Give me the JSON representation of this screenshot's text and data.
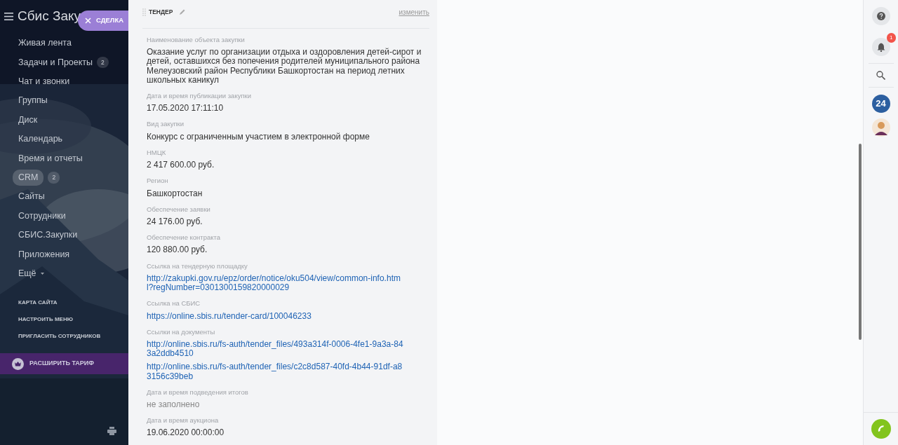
{
  "sidebar": {
    "title": "Сбис Заку",
    "action_button": "СДЕЛКА",
    "items": [
      {
        "label": "Живая лента",
        "selected": false
      },
      {
        "label": "Задачи и Проекты",
        "badge": "2",
        "selected": false
      },
      {
        "label": "Чат и звонки",
        "selected": false
      },
      {
        "label": "Группы",
        "selected": false
      },
      {
        "label": "Диск",
        "selected": false
      },
      {
        "label": "Календарь",
        "selected": false
      },
      {
        "label": "Время и отчеты",
        "selected": false
      },
      {
        "label": "CRM",
        "badge": "2",
        "selected": true
      },
      {
        "label": "Сайты",
        "selected": false
      },
      {
        "label": "Сотрудники",
        "selected": false
      },
      {
        "label": "СБИС.Закупки",
        "selected": false
      },
      {
        "label": "Приложения",
        "selected": false
      },
      {
        "label": "Ещё",
        "selected": false,
        "dropdown": true
      }
    ],
    "links": [
      "КАРТА САЙТА",
      "НАСТРОИТЬ МЕНЮ",
      "ПРИГЛАСИТЬ СОТРУДНИКОВ"
    ],
    "upgrade": "РАСШИРИТЬ ТАРИФ"
  },
  "panel": {
    "title": "ТЕНДЕР",
    "edit_link": "изменить",
    "fields": [
      {
        "label": "Наименование объекта закупки",
        "kind": "text",
        "values": [
          "Оказание услуг по организации отдыха и оздоровления детей-сирот и детей, оставшихся без попечения родителей муниципального района Мелеузовский район Республики Башкортостан на период летних школьных каникул"
        ]
      },
      {
        "label": "Дата и время публикации закупки",
        "kind": "text",
        "values": [
          "17.05.2020 17:11:10"
        ]
      },
      {
        "label": "Вид закупки",
        "kind": "text",
        "values": [
          "Конкурс с ограниченным участием в электронной форме"
        ]
      },
      {
        "label": "НМЦК",
        "kind": "text",
        "values": [
          "2 417 600.00 руб."
        ]
      },
      {
        "label": "Регион",
        "kind": "text",
        "values": [
          "Башкортостан"
        ]
      },
      {
        "label": "Обеспечение заявки",
        "kind": "text",
        "values": [
          "24 176.00 руб."
        ]
      },
      {
        "label": "Обеспечение контракта",
        "kind": "text",
        "values": [
          "120 880.00 руб."
        ]
      },
      {
        "label": "Ссылка на тендерную площадку",
        "kind": "link",
        "values": [
          "http://zakupki.gov.ru/epz/order/notice/oku504/view/common-info.html?regNumber=0301300159820000029"
        ]
      },
      {
        "label": "Ссылка на СБИС",
        "kind": "link",
        "values": [
          "https://online.sbis.ru/tender-card/100046233"
        ]
      },
      {
        "label": "Ссылки на документы",
        "kind": "link",
        "values": [
          "http://online.sbis.ru/fs-auth/tender_files/493a314f-0006-4fe1-9a3a-843a2ddb4510",
          "http://online.sbis.ru/fs-auth/tender_files/c2c8d587-40fd-4b44-91df-a83156c39beb"
        ]
      },
      {
        "label": "Дата и время подведения итогов",
        "kind": "empty",
        "values": [
          "не заполнено"
        ]
      },
      {
        "label": "Дата и время аукциона",
        "kind": "text",
        "values": [
          "19.06.2020 00:00:00"
        ]
      }
    ]
  },
  "rightbar": {
    "notifications": "1",
    "app_badge": "24"
  }
}
